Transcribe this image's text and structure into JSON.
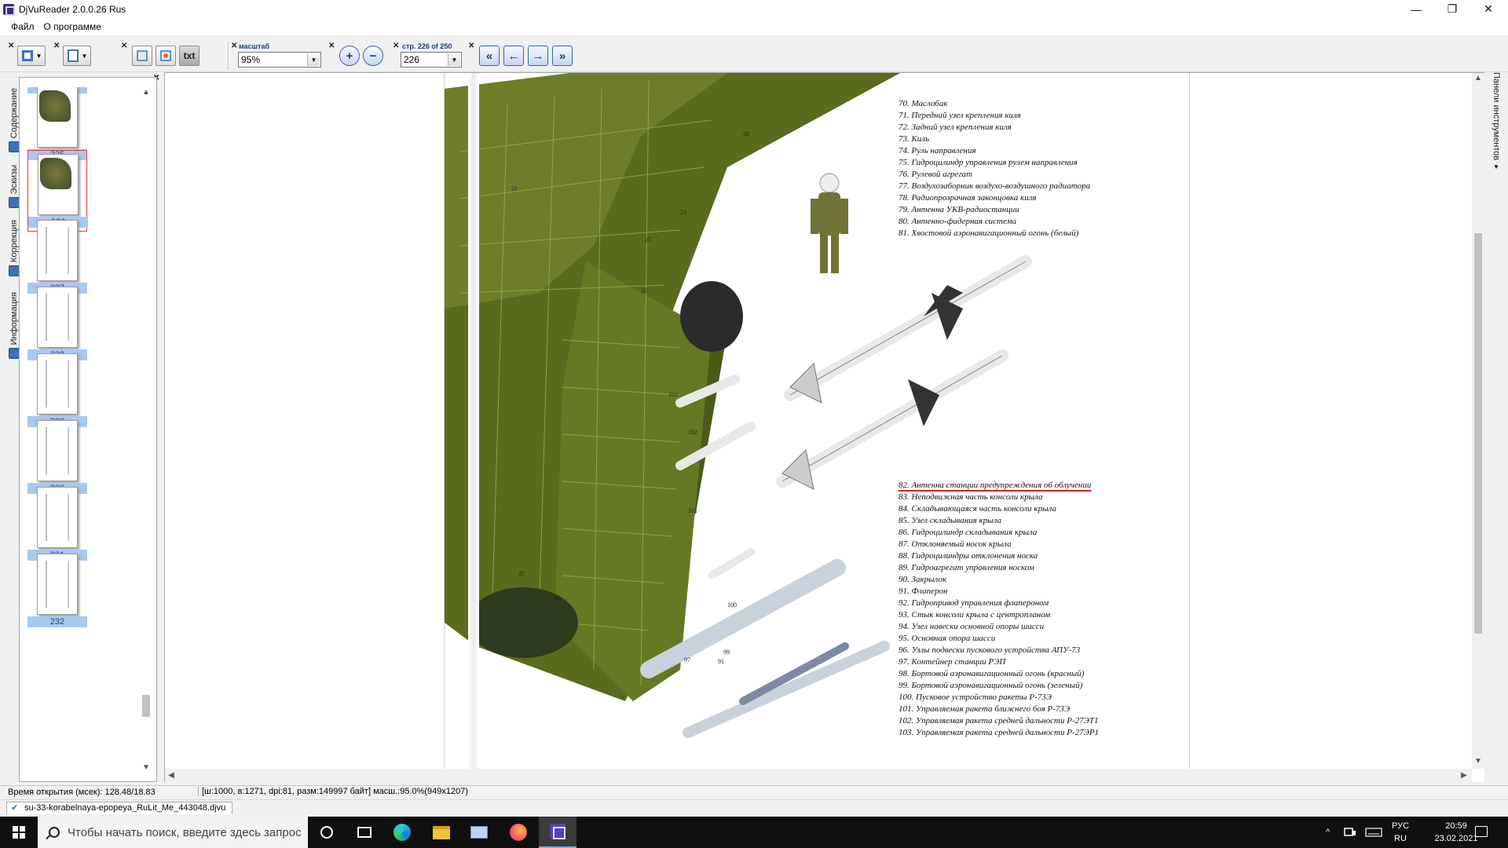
{
  "window": {
    "title": "DjVuReader 2.0.0.26 Rus",
    "controls": {
      "minimize": "—",
      "maximize": "❐",
      "close": "✕"
    }
  },
  "menu": {
    "items": [
      "Файл",
      "О программе"
    ]
  },
  "toolbar": {
    "scale_label": "масштаб",
    "scale_value": "95%",
    "page_label": "стр. 226 of 250",
    "page_value": "226",
    "text_button": "txt",
    "zoom_in": "+",
    "zoom_out": "−",
    "nav": {
      "first": "«",
      "prev": "←",
      "next": "→",
      "last": "»"
    }
  },
  "left_tabs": [
    "Содержание",
    "Эскизы",
    "Коррекция",
    "Информация"
  ],
  "thumbnails": {
    "pages": [
      "224",
      "225",
      "226",
      "227",
      "228",
      "229",
      "230",
      "231",
      "232"
    ],
    "selected": "226"
  },
  "right_panel": {
    "label": "Панели инструментов"
  },
  "document": {
    "legend_top": [
      "70. Маслобак",
      "71. Передний узел крепления киля",
      "72. Задний узел крепления киля",
      "73. Киль",
      "74. Руль направления",
      "75. Гидроцилиндр управления рулем направления",
      "76. Рулевой агрегат",
      "77. Воздухозаборник воздухо-воздушного радиатора",
      "78. Радиопрозрачная законцовка киля",
      "79. Антенна УКВ-радиостанции",
      "80. Антенно-фидерная система",
      "81. Хвостовой аэронавигационный огонь (белый)"
    ],
    "legend_highlight": "82. Антенна станции предупреждения об облучении",
    "legend_bottom": [
      "83. Неподвижная часть консоли крыла",
      "84. Складывающаяся часть консоли крыла",
      "85. Узел складывания крыла",
      "86. Гидроцилиндр складывания крыла",
      "87. Отклоняемый носок крыла",
      "88. Гидроцилиндры отклонения носка",
      "89. Гидроагрегат управления носком",
      "90. Закрылок",
      "91. Флаперон",
      "92. Гидропривод управления флапероном",
      "93. Стык консоли крыла с центропланом",
      "94. Узел навески основной опоры шасси",
      "95. Основная опора шасси",
      "96. Узлы подвески пускового устройства АПУ-73",
      "97. Контейнер станции РЭП",
      "98. Бортовой аэронавигационный огонь (красный)",
      "99. Бортовой аэронавигационный огонь (зеленый)",
      "100. Пусковое устройство ракеты Р-73Э",
      "101. Управляемая ракета ближнего боя Р-73Э",
      "102. Управляемая ракета средней дальности Р-27ЭТ1",
      "103. Управляемая ракета средней дальности Р-27ЭР1"
    ],
    "callouts": [
      "28",
      "23",
      "25",
      "26",
      "103",
      "102",
      "101",
      "100",
      "99",
      "97",
      "91",
      "90",
      "87",
      "5",
      "31"
    ]
  },
  "status": {
    "open_time": "Время открытия (мсек): 128.48/18.83",
    "page_info": "[ш:1000, в:1271, dpi:81, разм:149997 байт] масш.:95.0%(949x1207)"
  },
  "document_tab": {
    "filename": "su-33-korabelnaya-epopeya_RuLit_Me_443048.djvu"
  },
  "taskbar": {
    "search_placeholder": "Чтобы начать поиск, введите здесь запрос",
    "tray_up": "^",
    "language_top": "РУС",
    "language_bottom": "RU",
    "time": "20:59",
    "date": "23.02.2021"
  }
}
